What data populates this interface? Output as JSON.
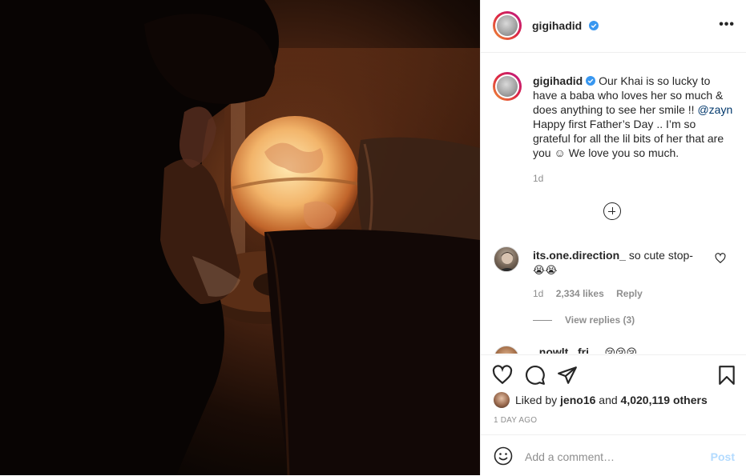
{
  "post": {
    "author": {
      "username": "gigihadid",
      "verified": true
    },
    "caption": {
      "username": "gigihadid",
      "text_part1": "Our Khai is so lucky to have a baba who loves her so much & does anything to see her smile !! ",
      "mention": "@zayn",
      "text_part2": " Happy first Father’s Day .. I’m so grateful for all the lil bits of her that are you ☺ We love you so much.",
      "time": "1d"
    },
    "comments": [
      {
        "username": "its.one.direction_",
        "text": "so cute stop-",
        "emoji": "😭😭",
        "time": "1d",
        "likes": "2,334 likes",
        "reply_label": "Reply",
        "view_replies": "View replies (3)"
      },
      {
        "username": "_nowlt...fri",
        "text": "...",
        "emoji": "😢😢😢"
      }
    ],
    "likes": {
      "prefix": "Liked by",
      "user": "jeno16",
      "conjunction": "and",
      "count": "4,020,119 others"
    },
    "date": "1 DAY AGO",
    "add_comment_placeholder": "Add a comment…",
    "post_label": "Post"
  },
  "icons": {
    "more": "more-options-icon",
    "like": "heart-icon",
    "comment": "comment-icon",
    "share": "share-icon",
    "save": "bookmark-icon",
    "emoji": "emoji-icon",
    "load_more": "plus-circle-icon"
  },
  "colors": {
    "verified": "#3897f0",
    "link": "#00376b",
    "secondary": "#8e8e8e",
    "post_disabled": "#b3dbff"
  }
}
